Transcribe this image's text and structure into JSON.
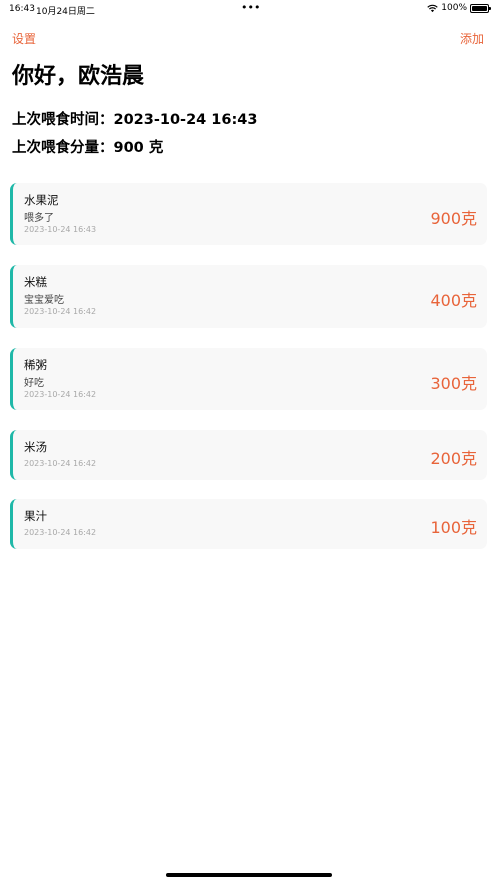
{
  "status_bar": {
    "time": "16:43",
    "date": "10月24日周二",
    "dots": "•••",
    "battery": "100%"
  },
  "nav": {
    "left": "设置",
    "right": "添加"
  },
  "greeting": "你好，欧浩晨",
  "last_feed": {
    "time_label": "上次喂食时间：",
    "time_value": "2023-10-24 16:43",
    "amount_label": "上次喂食分量：",
    "amount_value": "900 克"
  },
  "records": [
    {
      "name": "水果泥",
      "note": "喂多了",
      "time": "2023-10-24 16:43",
      "amount": "900克"
    },
    {
      "name": "米糕",
      "note": "宝宝爱吃",
      "time": "2023-10-24 16:42",
      "amount": "400克"
    },
    {
      "name": "稀粥",
      "note": "好吃",
      "time": "2023-10-24 16:42",
      "amount": "300克"
    },
    {
      "name": "米汤",
      "note": "",
      "time": "2023-10-24 16:42",
      "amount": "200克"
    },
    {
      "name": "果汁",
      "note": "",
      "time": "2023-10-24 16:42",
      "amount": "100克"
    }
  ],
  "colors": {
    "accent": "#e8643a",
    "record_bar": "#1fb8a8",
    "card_bg": "#f8f8f8"
  }
}
